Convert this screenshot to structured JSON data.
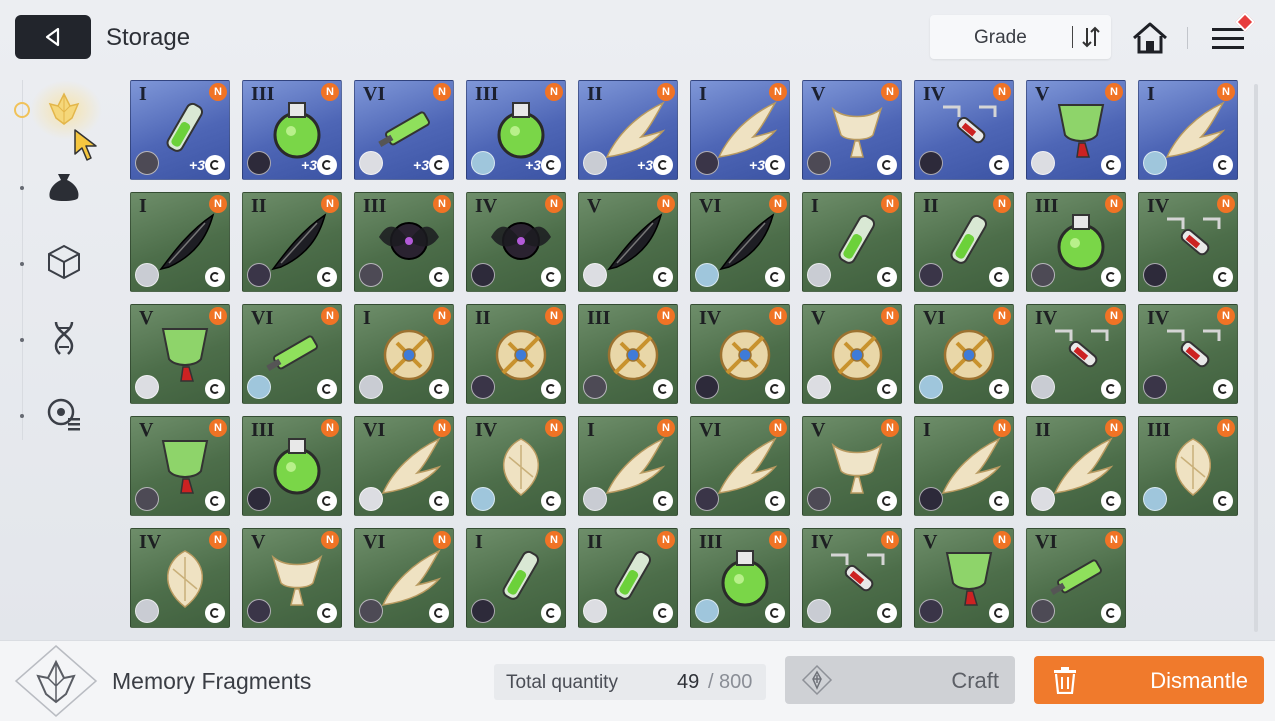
{
  "header": {
    "title": "Storage",
    "sort_label": "Grade"
  },
  "sidebar": {
    "items": [
      {
        "name": "sidebar-item-memory-fragments",
        "icon": "fragment-crystal-icon",
        "active": true
      },
      {
        "name": "sidebar-item-bag",
        "icon": "pouch-icon",
        "active": false
      },
      {
        "name": "sidebar-item-materials",
        "icon": "cube-icon",
        "active": false
      },
      {
        "name": "sidebar-item-dna",
        "icon": "dna-icon",
        "active": false
      },
      {
        "name": "sidebar-item-list",
        "icon": "list-settings-icon",
        "active": false
      }
    ]
  },
  "grid": {
    "items": [
      {
        "grade": "I",
        "color": "blue",
        "plus": "+3",
        "art": "vial"
      },
      {
        "grade": "III",
        "color": "blue",
        "plus": "+3",
        "art": "flask"
      },
      {
        "grade": "VI",
        "color": "blue",
        "plus": "+3",
        "art": "syringe"
      },
      {
        "grade": "III",
        "color": "blue",
        "plus": "+3",
        "art": "flask"
      },
      {
        "grade": "II",
        "color": "blue",
        "plus": "+3",
        "art": "wing"
      },
      {
        "grade": "I",
        "color": "blue",
        "plus": "+3",
        "art": "wing"
      },
      {
        "grade": "V",
        "color": "blue",
        "plus": "",
        "art": "cup"
      },
      {
        "grade": "IV",
        "color": "blue",
        "plus": "",
        "art": "chain"
      },
      {
        "grade": "V",
        "color": "blue",
        "plus": "",
        "art": "goblet"
      },
      {
        "grade": "I",
        "color": "blue",
        "plus": "",
        "art": "wing"
      },
      {
        "grade": "I",
        "color": "green",
        "plus": "",
        "art": "feather"
      },
      {
        "grade": "II",
        "color": "green",
        "plus": "",
        "art": "feather"
      },
      {
        "grade": "III",
        "color": "green",
        "plus": "",
        "art": "orb"
      },
      {
        "grade": "IV",
        "color": "green",
        "plus": "",
        "art": "orb"
      },
      {
        "grade": "V",
        "color": "green",
        "plus": "",
        "art": "feather"
      },
      {
        "grade": "VI",
        "color": "green",
        "plus": "",
        "art": "feather"
      },
      {
        "grade": "I",
        "color": "green",
        "plus": "",
        "art": "vial"
      },
      {
        "grade": "II",
        "color": "green",
        "plus": "",
        "art": "vial"
      },
      {
        "grade": "III",
        "color": "green",
        "plus": "",
        "art": "flask"
      },
      {
        "grade": "IV",
        "color": "green",
        "plus": "",
        "art": "chain"
      },
      {
        "grade": "V",
        "color": "green",
        "plus": "",
        "art": "goblet"
      },
      {
        "grade": "VI",
        "color": "green",
        "plus": "",
        "art": "syringe"
      },
      {
        "grade": "I",
        "color": "green",
        "plus": "",
        "art": "gold"
      },
      {
        "grade": "II",
        "color": "green",
        "plus": "",
        "art": "gold"
      },
      {
        "grade": "III",
        "color": "green",
        "plus": "",
        "art": "gold"
      },
      {
        "grade": "IV",
        "color": "green",
        "plus": "",
        "art": "gold"
      },
      {
        "grade": "V",
        "color": "green",
        "plus": "",
        "art": "gold"
      },
      {
        "grade": "VI",
        "color": "green",
        "plus": "",
        "art": "gold"
      },
      {
        "grade": "IV",
        "color": "green",
        "plus": "",
        "art": "chain"
      },
      {
        "grade": "IV",
        "color": "green",
        "plus": "",
        "art": "chain"
      },
      {
        "grade": "V",
        "color": "green",
        "plus": "",
        "art": "goblet"
      },
      {
        "grade": "III",
        "color": "green",
        "plus": "",
        "art": "flask"
      },
      {
        "grade": "VI",
        "color": "green",
        "plus": "",
        "art": "wing"
      },
      {
        "grade": "IV",
        "color": "green",
        "plus": "",
        "art": "shell"
      },
      {
        "grade": "I",
        "color": "green",
        "plus": "",
        "art": "wing"
      },
      {
        "grade": "VI",
        "color": "green",
        "plus": "",
        "art": "wing"
      },
      {
        "grade": "V",
        "color": "green",
        "plus": "",
        "art": "cup"
      },
      {
        "grade": "I",
        "color": "green",
        "plus": "",
        "art": "wing"
      },
      {
        "grade": "II",
        "color": "green",
        "plus": "",
        "art": "wing"
      },
      {
        "grade": "III",
        "color": "green",
        "plus": "",
        "art": "shell"
      },
      {
        "grade": "IV",
        "color": "green",
        "plus": "",
        "art": "shell"
      },
      {
        "grade": "V",
        "color": "green",
        "plus": "",
        "art": "cup"
      },
      {
        "grade": "VI",
        "color": "green",
        "plus": "",
        "art": "wing"
      },
      {
        "grade": "I",
        "color": "green",
        "plus": "",
        "art": "vial"
      },
      {
        "grade": "II",
        "color": "green",
        "plus": "",
        "art": "vial"
      },
      {
        "grade": "III",
        "color": "green",
        "plus": "",
        "art": "flask"
      },
      {
        "grade": "IV",
        "color": "green",
        "plus": "",
        "art": "chain"
      },
      {
        "grade": "V",
        "color": "green",
        "plus": "",
        "art": "goblet"
      },
      {
        "grade": "VI",
        "color": "green",
        "plus": "",
        "art": "syringe"
      }
    ],
    "badge_text": "N"
  },
  "footer": {
    "item_label": "Memory Fragments",
    "quantity_label": "Total quantity",
    "quantity_current": "49",
    "quantity_separator": "/",
    "quantity_max": "800",
    "craft_label": "Craft",
    "dismantle_label": "Dismantle"
  },
  "colors": {
    "accent_orange": "#f07a2c",
    "card_blue": "#4e66b6",
    "card_green": "#4d6e4a",
    "badge_orange": "#f07325"
  }
}
